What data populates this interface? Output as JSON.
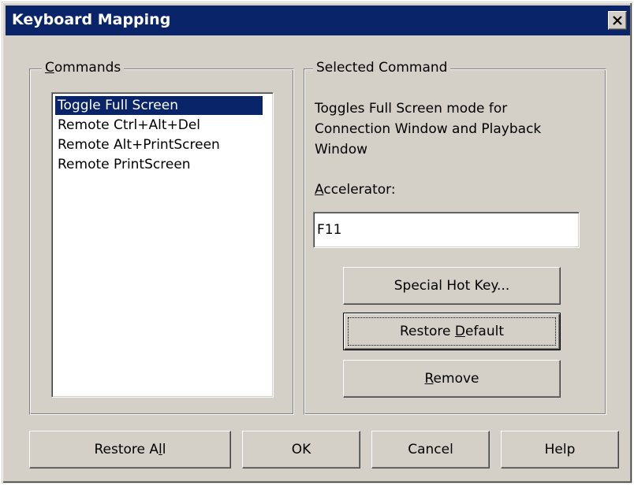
{
  "window": {
    "title": "Keyboard Mapping"
  },
  "commands": {
    "legend": "Commands",
    "legend_underline": "C",
    "legend_rest": "ommands",
    "items": [
      "Toggle Full Screen",
      "Remote Ctrl+Alt+Del",
      "Remote Alt+PrintScreen",
      "Remote PrintScreen"
    ],
    "selected_index": 0
  },
  "selected_command": {
    "legend": "Selected Command",
    "description": "Toggles Full Screen mode for Connection Window and Playback Window",
    "description_lines": [
      "Toggles Full Screen mode for",
      "Connection Window and Playback",
      "Window"
    ],
    "accelerator_label_u": "A",
    "accelerator_label_rest": "ccelerator:",
    "accelerator_value": "F11",
    "buttons": {
      "special_hot_key": "Special Hot Key...",
      "restore_default_pre": "Restore ",
      "restore_default_u": "D",
      "restore_default_post": "efault",
      "remove_u": "R",
      "remove_rest": "emove"
    }
  },
  "footer": {
    "restore_all_pre": "Restore A",
    "restore_all_u": "l",
    "restore_all_post": "l",
    "ok": "OK",
    "cancel": "Cancel",
    "help": "Help"
  },
  "colors": {
    "dialog_face": "#d4d0c8",
    "titlebar": "#0a246a",
    "selection": "#0a246a"
  }
}
